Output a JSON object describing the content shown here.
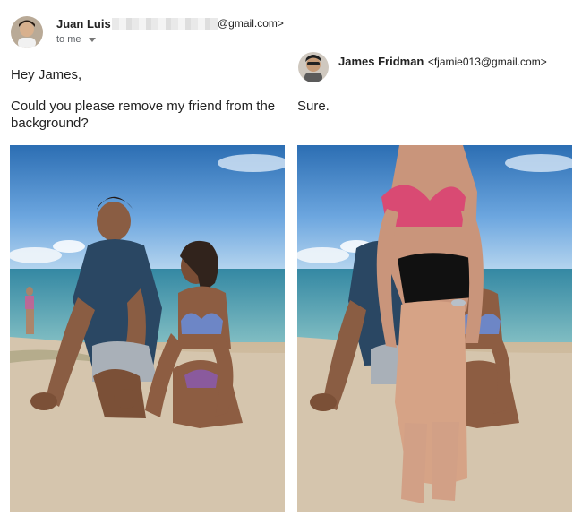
{
  "left_email": {
    "sender_name": "Juan Luis",
    "sender_email_suffix": "@gmail.com>",
    "recipient_label": "to me",
    "greeting": "Hey James,",
    "message": "Could you please remove my friend from the background?"
  },
  "right_email": {
    "sender_name": "James Fridman",
    "sender_email": "<fjamie013@gmail.com>",
    "message": "Sure."
  },
  "colors": {
    "sky": "#3f7fc8",
    "sea": "#2f8fa6",
    "sand": "#d9cbb5"
  },
  "icons": {
    "left_avatar": "avatar-photo",
    "right_avatar": "avatar-photo",
    "dropdown": "chevron-down-icon"
  }
}
